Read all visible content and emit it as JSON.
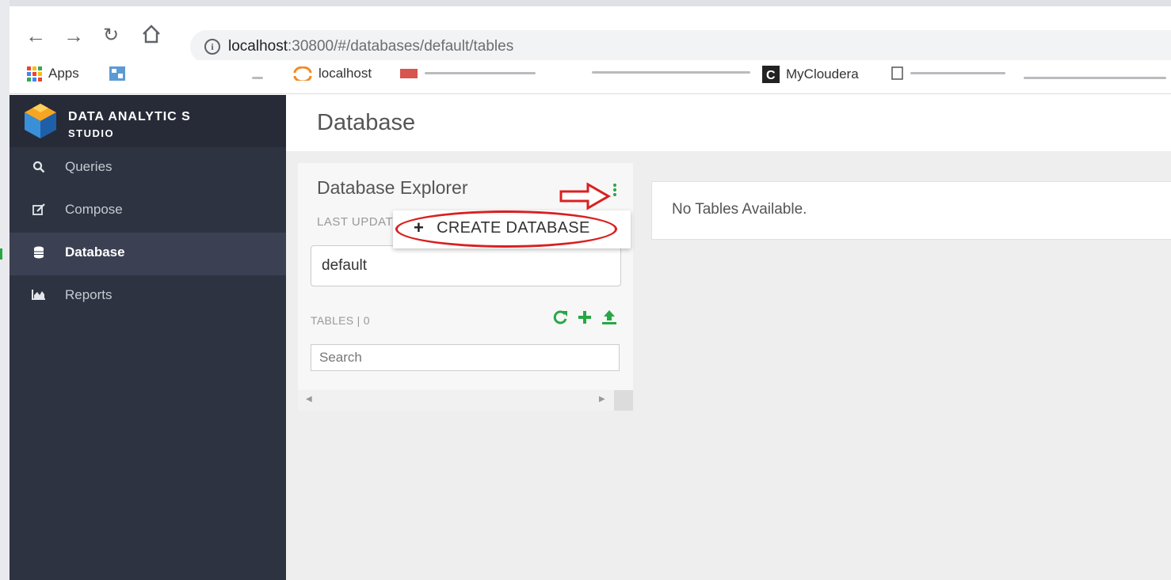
{
  "browser": {
    "url_host": "localhost",
    "url_rest": ":30800/#/databases/default/tables",
    "bookmarks": {
      "apps": "Apps",
      "localhost": "localhost",
      "mycloudera": "MyCloudera"
    }
  },
  "sidebar": {
    "brand_name": "DATA ANALYTIC S",
    "brand_sub": "STUDIO",
    "items": [
      {
        "label": "Queries",
        "icon": "search-icon"
      },
      {
        "label": "Compose",
        "icon": "edit-icon"
      },
      {
        "label": "Database",
        "icon": "database-icon",
        "active": true
      },
      {
        "label": "Reports",
        "icon": "chart-icon"
      }
    ]
  },
  "main": {
    "title": "Database",
    "explorer": {
      "title": "Database Explorer",
      "last_updated": "LAST UPDAT",
      "selected_db": "default",
      "tables_label": "TABLES  |  0",
      "search_placeholder": "Search"
    },
    "tables_panel": {
      "message": "No Tables Available."
    },
    "dropdown": {
      "create_database": "CREATE DATABASE"
    }
  },
  "colors": {
    "sidebar_bg": "#2e3341",
    "accent_green": "#28a745",
    "annotation_red": "#d92020"
  }
}
